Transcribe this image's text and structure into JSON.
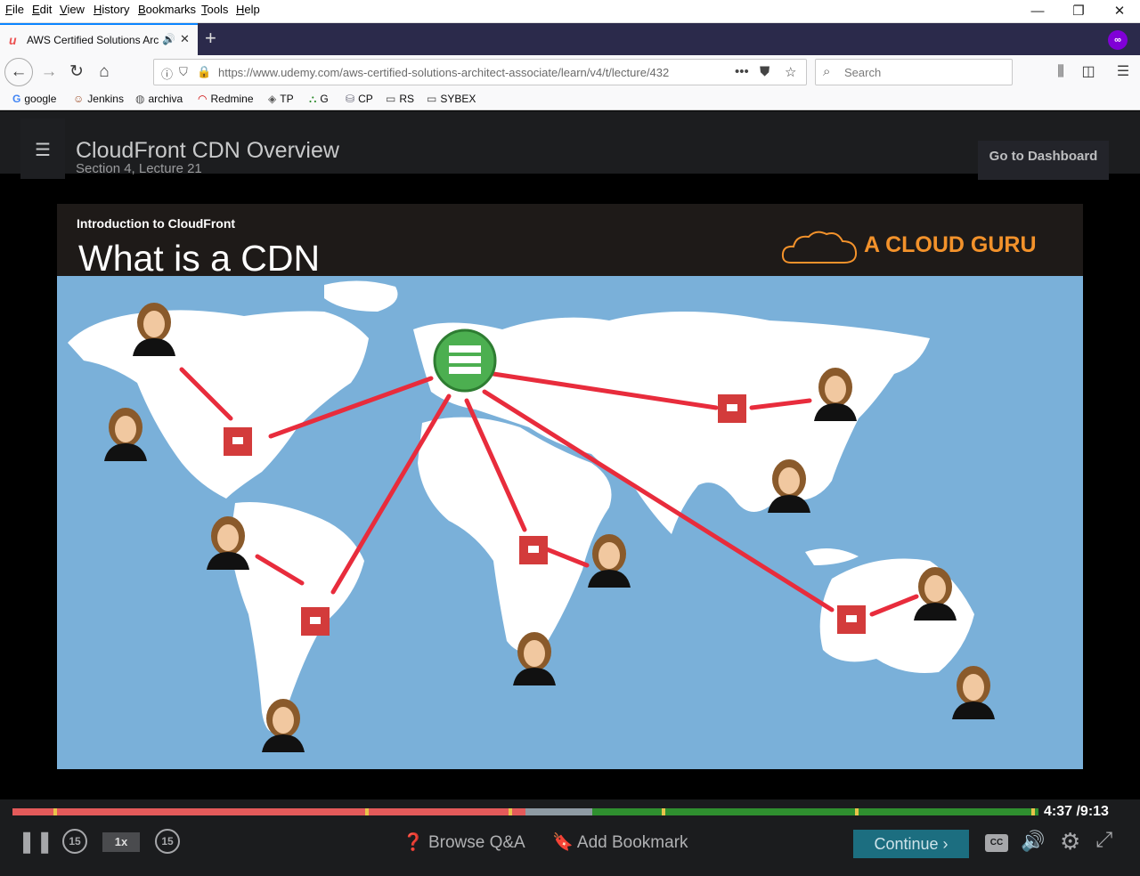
{
  "menu": [
    "File",
    "Edit",
    "View",
    "History",
    "Bookmarks",
    "Tools",
    "Help"
  ],
  "window_controls": {
    "minimize": "—",
    "restore": "❐",
    "close": "✕"
  },
  "tab": {
    "title": "AWS Certified Solutions Architect",
    "favicon": "u"
  },
  "url": {
    "text": "https://www.udemy.com/aws-certified-solutions-architect-associate/learn/v4/t/lecture/432"
  },
  "search": {
    "placeholder": "Search"
  },
  "bookmarks": [
    {
      "label": "google",
      "icon": "G"
    },
    {
      "label": "Jenkins",
      "icon": "☺"
    },
    {
      "label": "archiva",
      "icon": "◍"
    },
    {
      "label": "Redmine",
      "icon": "◠"
    },
    {
      "label": "TP",
      "icon": "◈"
    },
    {
      "label": "G",
      "icon": "⛬"
    },
    {
      "label": "CP",
      "icon": "⛁"
    },
    {
      "label": "RS",
      "icon": "▭"
    },
    {
      "label": "SYBEX",
      "icon": "▭"
    }
  ],
  "lecture": {
    "title": "CloudFront CDN Overview",
    "subtitle": "Section 4, Lecture 21",
    "dashboard": "Go to Dashboard"
  },
  "slide": {
    "intro": "Introduction to CloudFront",
    "title": "What is a CDN",
    "brand": "A CLOUD GURU"
  },
  "player": {
    "time_current": "4:37",
    "time_total": "/9:13",
    "progress": 0.5,
    "buffered": 0.565,
    "speed": "1x",
    "rewind": "15",
    "forward": "15",
    "browse_qa": "Browse Q&A",
    "add_bookmark": "Add Bookmark",
    "continue": "Continue"
  },
  "colors": {
    "accent": "#ec5252",
    "map_sea": "#7ab0d9",
    "edge_box": "#d33b3b",
    "origin": "#4caf50",
    "brand": "#f3922b"
  }
}
